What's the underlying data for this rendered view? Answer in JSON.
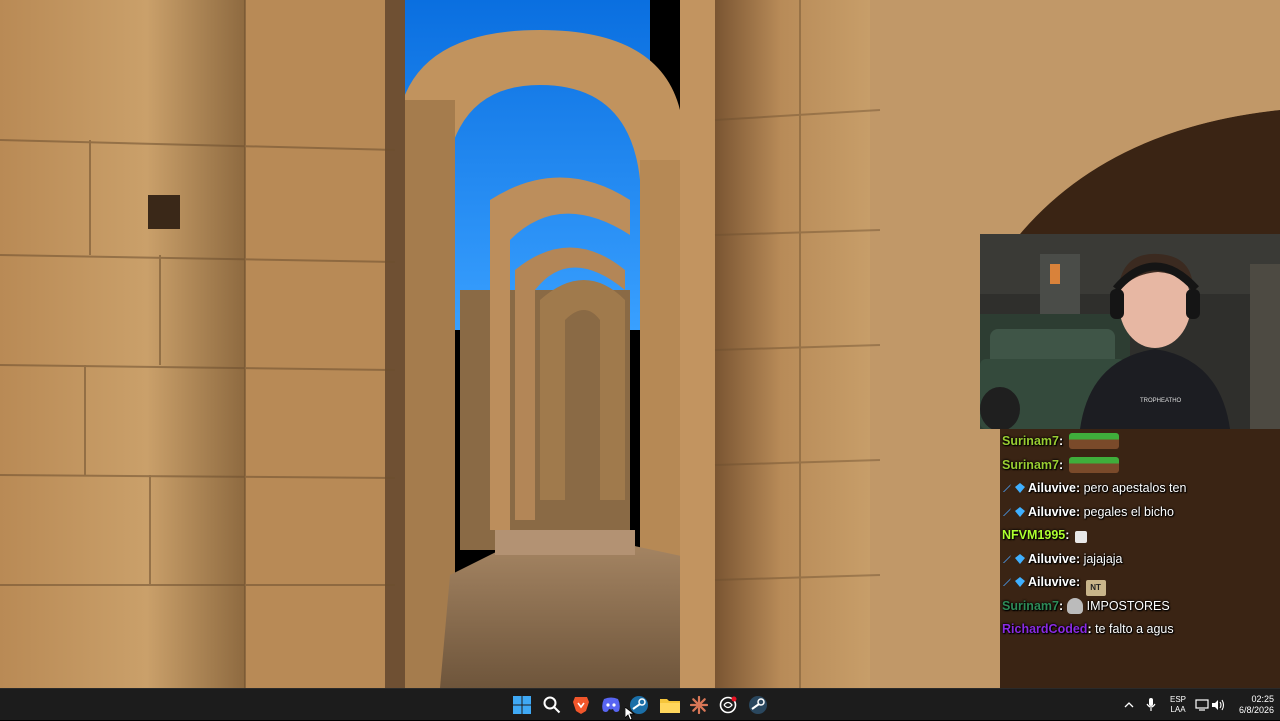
{
  "chat": {
    "messages": [
      {
        "user": "Surinam7",
        "user_color": "#9acd32",
        "badges": [],
        "text": "",
        "emote": "grass"
      },
      {
        "user": "Surinam7",
        "user_color": "#9acd32",
        "badges": [],
        "text": "",
        "emote": "grass"
      },
      {
        "user": "Ailuvive",
        "user_color": "#ffffff",
        "badges": [
          "sword-badge",
          "gem-badge"
        ],
        "text": "pero apestalos ten",
        "emote": ""
      },
      {
        "user": "Ailuvive",
        "user_color": "#ffffff",
        "badges": [
          "sword-badge",
          "gem-badge"
        ],
        "text": "pegales el bicho",
        "emote": ""
      },
      {
        "user": "NFVM1995",
        "user_color": "#adff2f",
        "badges": [],
        "text": "",
        "emote": "small"
      },
      {
        "user": "Ailuvive",
        "user_color": "#ffffff",
        "badges": [
          "sword-badge",
          "gem-badge"
        ],
        "text": "jajajaja",
        "emote": ""
      },
      {
        "user": "Ailuvive",
        "user_color": "#ffffff",
        "badges": [
          "sword-badge",
          "gem-badge"
        ],
        "text": "",
        "emote": "nt"
      },
      {
        "user": "Surinam7",
        "user_color": "#2e8b57",
        "badges": [],
        "text": "IMPOSTORES",
        "emote": "ghost"
      },
      {
        "user": "RichardCoded",
        "user_color": "#8a2be2",
        "badges": [],
        "text": "te falto a agus",
        "emote": ""
      }
    ]
  },
  "taskbar": {
    "icons": [
      "windows-start-icon",
      "search-icon",
      "brave-browser-icon",
      "discord-icon",
      "steam-store-icon",
      "file-explorer-icon",
      "claude-icon",
      "chatgpt-icon",
      "steam-icon"
    ],
    "tray": {
      "language_line1": "ESP",
      "language_line2": "LAA",
      "time": "02:25",
      "date": "6/8/2026"
    }
  },
  "colors": {
    "taskbar_bg": "#1c1c1c",
    "sky": "#1e90ff",
    "stone": "#c8965a"
  }
}
